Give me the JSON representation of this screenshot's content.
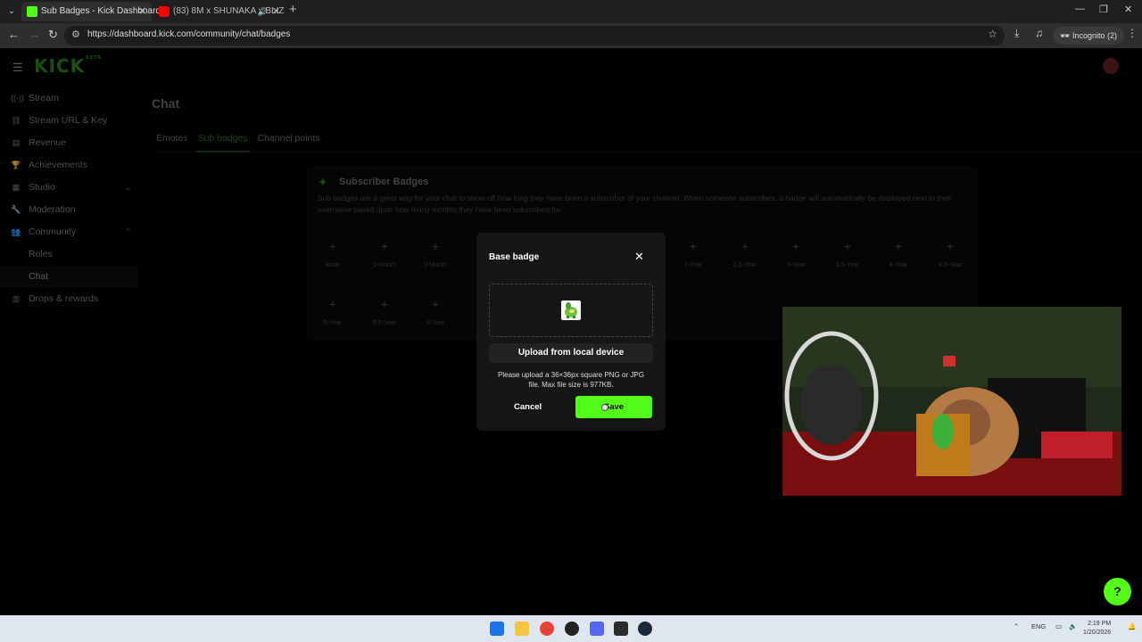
{
  "browser": {
    "tabs": [
      {
        "title": "Sub Badges - Kick Dashboard",
        "active": true,
        "favicon_color": "#53fc18"
      },
      {
        "title": "(83) 8M x SHUNAKA x BLIZ",
        "active": false,
        "favicon_color": "#ff0000"
      }
    ],
    "url": "https://dashboard.kick.com/community/chat/badges",
    "incognito_label": "Incognito (2)"
  },
  "app": {
    "logo_text": "KICK",
    "logo_sup": "BETA",
    "accent_color": "#53fc18"
  },
  "sidebar": {
    "items": [
      {
        "label": "Stream",
        "icon": "broadcast-icon"
      },
      {
        "label": "Stream URL & Key",
        "icon": "link-icon"
      },
      {
        "label": "Revenue",
        "icon": "revenue-icon"
      },
      {
        "label": "Achievements",
        "icon": "trophy-icon"
      },
      {
        "label": "Studio",
        "icon": "studio-icon",
        "chevron": "down"
      },
      {
        "label": "Moderation",
        "icon": "wrench-icon"
      },
      {
        "label": "Community",
        "icon": "community-icon",
        "chevron": "up"
      },
      {
        "label": "Roles",
        "sub": true
      },
      {
        "label": "Chat",
        "sub": true,
        "active": true
      },
      {
        "label": "Drops & rewards",
        "icon": "gift-icon"
      }
    ]
  },
  "page": {
    "title": "Chat",
    "tabs": [
      "Emotes",
      "Sub badges",
      "Channel points"
    ],
    "selected_tab": "Sub badges"
  },
  "card": {
    "title": "Subscriber Badges",
    "description": "Sub badges are a great way for your chat to show off how long they have been a subscriber of your channel. When someone subscribes, a badge will automatically be displayed next to their username based upon how many months they have been subscribed for.",
    "slots_row1": [
      "Base",
      "2-Month",
      "3-Month",
      "",
      "",
      "",
      "",
      "2-Year",
      "2.5-Year",
      "3-Year",
      "3.5-Year",
      "4-Year",
      "4.5-Year"
    ],
    "slots_row2": [
      "5-Year",
      "5.5-Year",
      "6-Year",
      ""
    ]
  },
  "modal": {
    "title": "Base badge",
    "upload_label": "Upload from local device",
    "hint": "Please upload a 36×36px square PNG or JPG file. Max file size is 977KB.",
    "cancel_label": "Cancel",
    "save_label": "Save"
  },
  "taskbar": {
    "lang": "ENG",
    "time": "2:19 PM",
    "date": "1/20/2026"
  }
}
